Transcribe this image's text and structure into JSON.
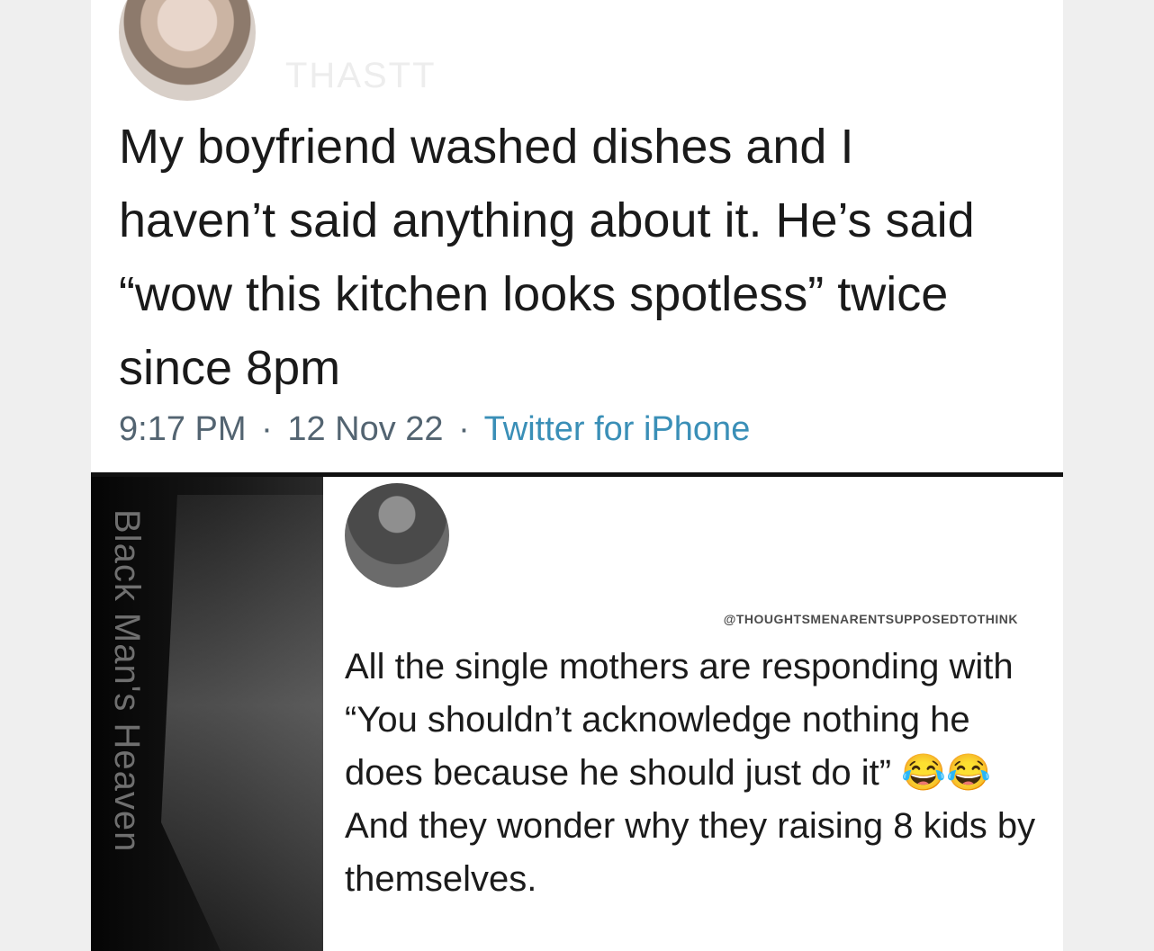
{
  "top_tweet": {
    "watermark": "THASTT",
    "text": "My boyfriend washed dishes and I haven’t said anything about it. He’s said “wow this kitchen looks spotless” twice since 8pm",
    "time": "9:17 PM",
    "separator": "·",
    "date": "12 Nov 22",
    "client": "Twitter for iPhone"
  },
  "bottom_post": {
    "banner_text": "Black Man's Heaven",
    "handle": "@THOUGHTSMENARENTSUPPOSEDTOTHINK",
    "text": "All the single mothers are responding with “You shouldn’t acknowledge nothing he does because he should just do it” 😂😂 And they wonder why they raising 8 kids by themselves."
  }
}
